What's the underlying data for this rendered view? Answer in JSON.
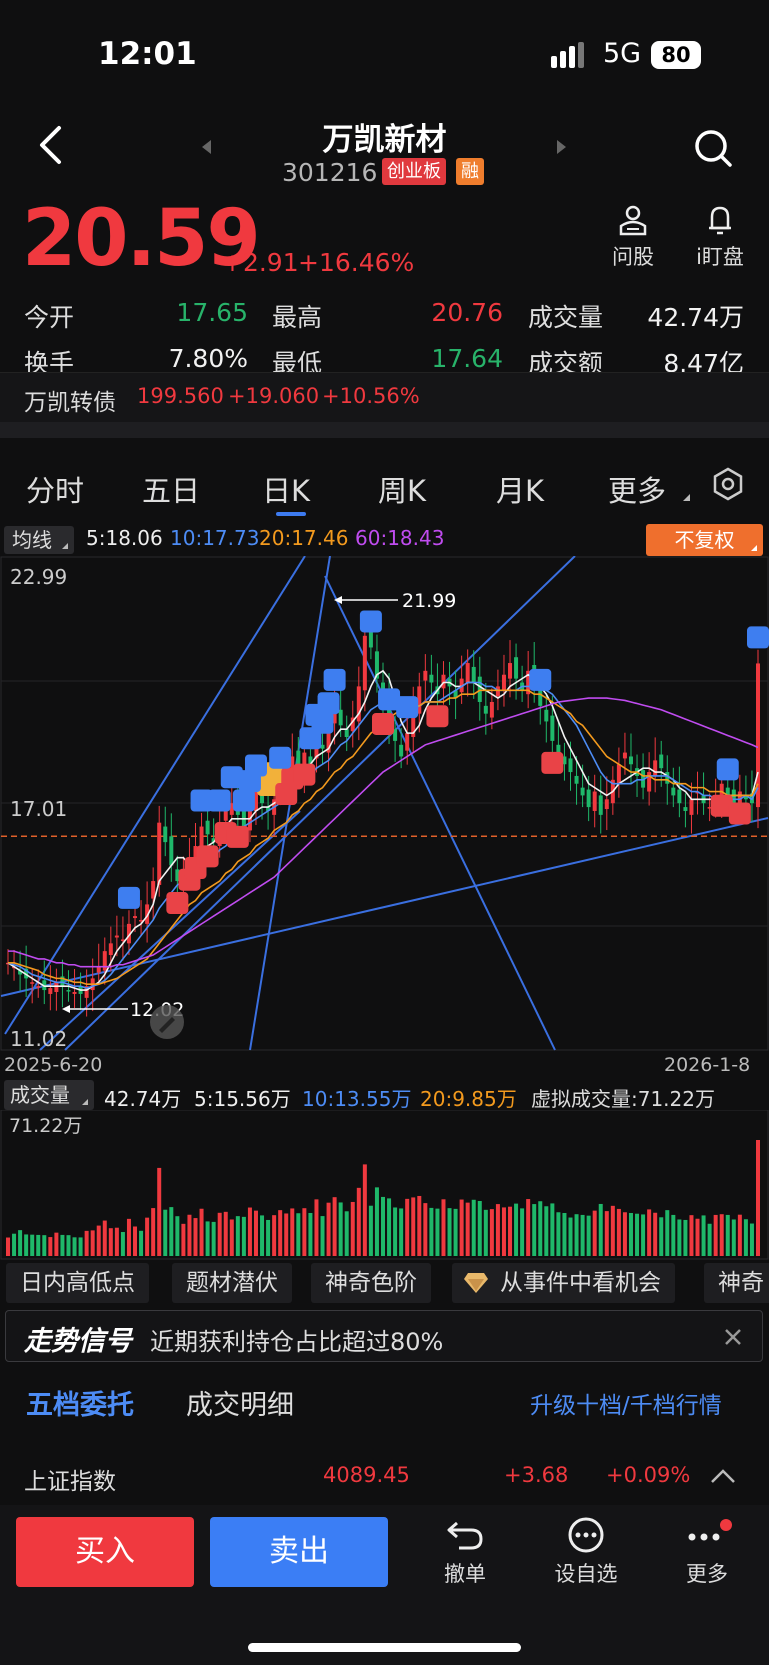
{
  "status": {
    "time": "12:01",
    "network": "5G",
    "battery": "80"
  },
  "stock": {
    "name": "万凯新材",
    "code": "301216",
    "tag_board": "创业板",
    "tag_margin": "融",
    "price": "20.59",
    "change": "+2.91",
    "change_pct": "+16.46%"
  },
  "actions": {
    "ask": "问股",
    "watch": "i盯盘"
  },
  "stats": [
    {
      "label": "今开",
      "value": "17.65",
      "color": "#28b36a"
    },
    {
      "label": "最高",
      "value": "20.76",
      "color": "#f0393f"
    },
    {
      "label": "成交量",
      "value": "42.74万",
      "color": "#f2f2f2"
    },
    {
      "label": "换手",
      "value": "7.80%",
      "color": "#f2f2f2"
    },
    {
      "label": "最低",
      "value": "17.64",
      "color": "#28b36a"
    },
    {
      "label": "成交额",
      "value": "8.47亿",
      "color": "#f2f2f2"
    }
  ],
  "bond": {
    "name": "万凯转债",
    "price": "199.560",
    "change": "+19.060",
    "pct": "+10.56%"
  },
  "tabs": [
    "分时",
    "五日",
    "日K",
    "周K",
    "月K",
    "更多"
  ],
  "active_tab": "日K",
  "ma": {
    "button": "均线",
    "ma5": "5:18.06",
    "ma10": "10:17.73",
    "ma20": "20:17.46",
    "ma60": "60:18.43",
    "adjust": "不复权"
  },
  "chart_data": {
    "type": "candlestick",
    "y_labels": {
      "top": "22.99",
      "mid": "17.01",
      "bottom": "11.02"
    },
    "ylim": [
      11.02,
      22.99
    ],
    "annotations": {
      "high": "21.99",
      "low": "12.02"
    },
    "dates": {
      "start": "2025-6-20",
      "end": "2026-1-8"
    },
    "ref_line": 16.15,
    "closes": [
      12.9,
      12.8,
      12.6,
      12.5,
      12.4,
      12.3,
      12.2,
      12.25,
      12.4,
      12.3,
      12.2,
      12.15,
      12.1,
      12.3,
      12.5,
      12.8,
      13.2,
      13.4,
      13.6,
      13.5,
      13.9,
      14.1,
      14.0,
      14.4,
      15.0,
      16.5,
      16.0,
      15.4,
      15.0,
      15.2,
      15.6,
      15.9,
      16.4,
      16.2,
      16.0,
      16.4,
      16.8,
      17.0,
      16.7,
      16.4,
      16.9,
      17.3,
      17.0,
      16.8,
      17.1,
      17.5,
      17.8,
      18.2,
      17.9,
      18.3,
      18.0,
      18.6,
      18.4,
      18.9,
      19.5,
      19.0,
      18.7,
      19.2,
      20.0,
      21.3,
      21.0,
      20.2,
      19.6,
      19.0,
      18.6,
      18.2,
      18.8,
      19.4,
      20.0,
      20.4,
      20.1,
      19.8,
      20.3,
      20.0,
      19.7,
      20.2,
      20.6,
      20.1,
      19.6,
      19.3,
      19.6,
      20.0,
      20.3,
      20.6,
      20.2,
      19.9,
      20.4,
      20.0,
      19.5,
      19.1,
      18.6,
      18.3,
      18.0,
      17.8,
      17.5,
      17.2,
      16.9,
      17.3,
      16.7,
      17.1,
      17.6,
      18.0,
      18.3,
      18.0,
      17.7,
      17.4,
      17.8,
      18.1,
      17.9,
      17.5,
      17.2,
      17.0,
      16.8,
      17.1,
      17.3,
      17.0,
      16.9,
      17.2,
      17.5,
      17.2,
      17.0,
      17.3,
      17.1,
      17.0,
      20.59
    ],
    "ma5": [
      12.9,
      12.8,
      12.7,
      12.6,
      12.5,
      12.4,
      12.3,
      12.3,
      12.3,
      12.3,
      12.3,
      12.25,
      12.2,
      12.2,
      12.3,
      12.4,
      12.6,
      12.9,
      13.2,
      13.4,
      13.6,
      13.8,
      13.9,
      14.1,
      14.4,
      15.0,
      15.2,
      15.4,
      15.6,
      15.6,
      15.4,
      15.4,
      15.6,
      15.9,
      16.0,
      16.2,
      16.4,
      16.6,
      16.6,
      16.6,
      16.6,
      16.8,
      16.9,
      16.9,
      17.0,
      17.1,
      17.2,
      17.5,
      17.7,
      17.9,
      18.0,
      18.2,
      18.3,
      18.4,
      18.7,
      18.9,
      18.9,
      19.1,
      19.3,
      19.6,
      20.0,
      20.3,
      20.4,
      20.2,
      19.7,
      19.1,
      18.8,
      18.8,
      19.0,
      19.4,
      19.7,
      19.9,
      20.1,
      20.1,
      20.0,
      20.0,
      20.1,
      20.1,
      20.0,
      19.9,
      19.8,
      19.7,
      19.8,
      20.0,
      20.1,
      20.2,
      20.3,
      20.2,
      20.0,
      19.8,
      19.5,
      19.1,
      18.7,
      18.4,
      18.1,
      17.8,
      17.5,
      17.4,
      17.3,
      17.2,
      17.3,
      17.5,
      17.6,
      17.7,
      17.8,
      17.9,
      17.9,
      17.8,
      17.8,
      17.7,
      17.6,
      17.4,
      17.3,
      17.1,
      17.1,
      17.1,
      17.1,
      17.1,
      17.1,
      17.2,
      17.2,
      17.2,
      17.2,
      17.2,
      17.8
    ],
    "ma10": [
      12.9,
      12.85,
      12.8,
      12.7,
      12.6,
      12.55,
      12.5,
      12.45,
      12.4,
      12.4,
      12.35,
      12.3,
      12.3,
      12.25,
      12.3,
      12.35,
      12.45,
      12.6,
      12.8,
      13.0,
      13.2,
      13.4,
      13.6,
      13.8,
      14.0,
      14.3,
      14.5,
      14.7,
      14.9,
      15.0,
      15.2,
      15.3,
      15.4,
      15.5,
      15.6,
      15.8,
      15.9,
      16.1,
      16.3,
      16.4,
      16.5,
      16.6,
      16.7,
      16.8,
      16.9,
      17.0,
      17.1,
      17.3,
      17.4,
      17.6,
      17.7,
      17.9,
      18.0,
      18.1,
      18.3,
      18.5,
      18.6,
      18.8,
      19.0,
      19.2,
      19.4,
      19.5,
      19.6,
      19.7,
      19.6,
      19.5,
      19.4,
      19.4,
      19.5,
      19.6,
      19.6,
      19.6,
      19.7,
      19.8,
      19.9,
      20.0,
      20.1,
      20.1,
      20.1,
      20.0,
      20.0,
      19.9,
      19.9,
      19.9,
      19.9,
      20.0,
      20.0,
      20.0,
      20.0,
      19.9,
      19.8,
      19.6,
      19.4,
      19.2,
      19.0,
      18.7,
      18.4,
      18.1,
      17.8,
      17.6,
      17.5,
      17.5,
      17.5,
      17.5,
      17.6,
      17.6,
      17.7,
      17.7,
      17.7,
      17.7,
      17.6,
      17.5,
      17.4,
      17.3,
      17.3,
      17.2,
      17.2,
      17.1,
      17.1,
      17.1,
      17.1,
      17.1,
      17.2,
      17.1,
      17.4
    ],
    "ma20": [
      12.9,
      12.9,
      12.85,
      12.8,
      12.75,
      12.7,
      12.6,
      12.55,
      12.5,
      12.5,
      12.45,
      12.4,
      12.4,
      12.35,
      12.35,
      12.35,
      12.4,
      12.45,
      12.5,
      12.6,
      12.7,
      12.8,
      12.9,
      13.0,
      13.2,
      13.4,
      13.6,
      13.8,
      14.0,
      14.2,
      14.4,
      14.5,
      14.7,
      14.8,
      14.9,
      15.0,
      15.2,
      15.3,
      15.5,
      15.6,
      15.7,
      15.9,
      16.0,
      16.1,
      16.3,
      16.4,
      16.5,
      16.7,
      16.8,
      17.0,
      17.1,
      17.3,
      17.4,
      17.6,
      17.8,
      17.9,
      18.1,
      18.2,
      18.4,
      18.6,
      18.8,
      18.9,
      19.1,
      19.2,
      19.3,
      19.4,
      19.4,
      19.5,
      19.5,
      19.6,
      19.6,
      19.6,
      19.6,
      19.7,
      19.7,
      19.8,
      19.8,
      19.8,
      19.9,
      19.9,
      19.9,
      19.9,
      19.9,
      19.9,
      19.9,
      19.9,
      19.9,
      19.8,
      19.8,
      19.7,
      19.6,
      19.5,
      19.4,
      19.3,
      19.1,
      19.0,
      18.8,
      18.6,
      18.4,
      18.2,
      18.1,
      18.0,
      17.9,
      17.8,
      17.8,
      17.7,
      17.7,
      17.6,
      17.6,
      17.6,
      17.5,
      17.5,
      17.5,
      17.4,
      17.4,
      17.4,
      17.3,
      17.3,
      17.3,
      17.2,
      17.2,
      17.2,
      17.2,
      17.2,
      17.5
    ],
    "ma60": [
      13.2,
      13.2,
      13.15,
      13.1,
      13.05,
      13.0,
      13.0,
      12.95,
      12.9,
      12.9,
      12.85,
      12.85,
      12.8,
      12.8,
      12.8,
      12.8,
      12.8,
      12.8,
      12.85,
      12.85,
      12.9,
      12.95,
      13.0,
      13.05,
      13.1,
      13.2,
      13.3,
      13.4,
      13.5,
      13.6,
      13.7,
      13.8,
      13.9,
      14.0,
      14.1,
      14.2,
      14.3,
      14.4,
      14.5,
      14.6,
      14.7,
      14.8,
      14.9,
      15.0,
      15.1,
      15.25,
      15.4,
      15.55,
      15.7,
      15.85,
      16.0,
      16.15,
      16.3,
      16.45,
      16.6,
      16.75,
      16.9,
      17.05,
      17.2,
      17.35,
      17.5,
      17.65,
      17.8,
      17.9,
      18.0,
      18.1,
      18.2,
      18.3,
      18.4,
      18.5,
      18.55,
      18.6,
      18.65,
      18.7,
      18.75,
      18.8,
      18.85,
      18.9,
      18.95,
      19.0,
      19.05,
      19.1,
      19.15,
      19.2,
      19.25,
      19.3,
      19.35,
      19.4,
      19.45,
      19.5,
      19.55,
      19.6,
      19.62,
      19.64,
      19.66,
      19.68,
      19.7,
      19.7,
      19.7,
      19.7,
      19.68,
      19.66,
      19.64,
      19.6,
      19.56,
      19.52,
      19.48,
      19.44,
      19.4,
      19.34,
      19.28,
      19.22,
      19.16,
      19.1,
      19.04,
      18.98,
      18.92,
      18.86,
      18.8,
      18.74,
      18.68,
      18.62,
      18.56,
      18.5,
      18.43
    ]
  },
  "volume": {
    "button": "成交量",
    "current": "42.74万",
    "ma5": "5:15.56万",
    "ma10": "10:13.55万",
    "ma20": "20:9.85万",
    "virtual": "虚拟成交量:71.22万",
    "max_label": "71.22万"
  },
  "chips": [
    "日内高低点",
    "题材潜伏",
    "神奇色阶",
    "从事件中看机会",
    "神奇"
  ],
  "signal": {
    "title": "走势信号",
    "text": "近期获利持仓占比超过80%"
  },
  "bottom_tabs": {
    "orders": "五档委托",
    "detail": "成交明细",
    "upgrade": "升级十档/千档行情"
  },
  "index": {
    "name": "上证指数",
    "value": "4089.45",
    "change": "+3.68",
    "pct": "+0.09%"
  },
  "footer": {
    "buy": "买入",
    "sell": "卖出",
    "cancel": "撤单",
    "watchlist": "设自选",
    "more": "更多"
  }
}
